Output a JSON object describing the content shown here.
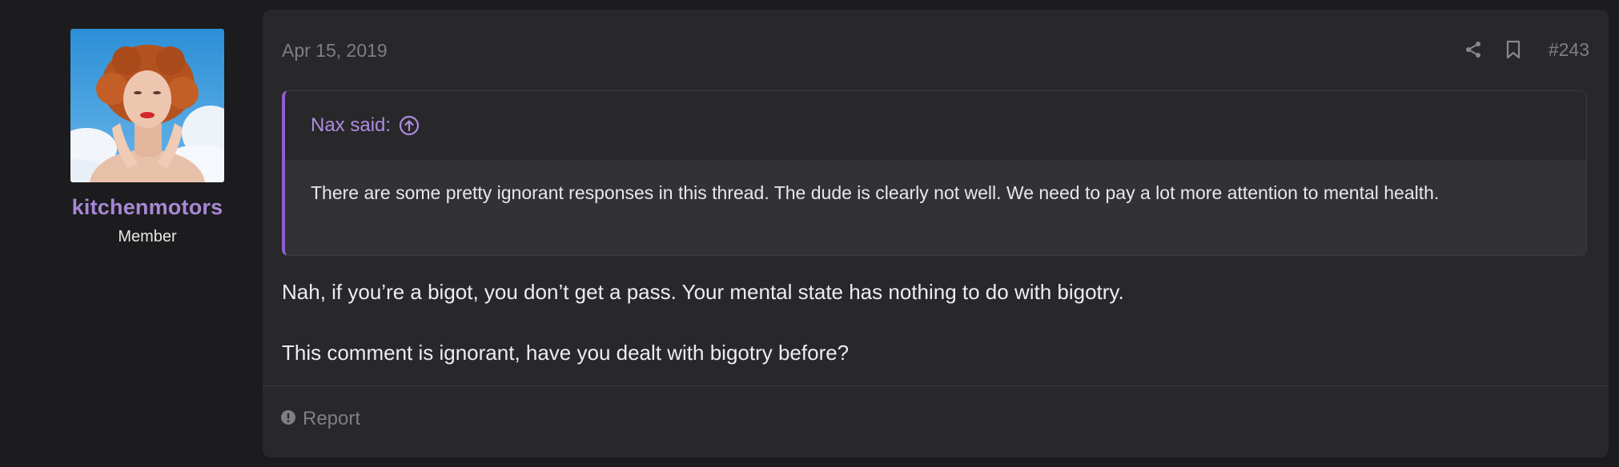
{
  "user": {
    "username": "kitchenmotors",
    "title": "Member",
    "avatar_icon": "user-avatar-photo"
  },
  "post": {
    "date": "Apr 15, 2019",
    "number": "#243",
    "share_icon": "share-icon",
    "bookmark_icon": "bookmark-icon",
    "quote": {
      "attribution": "Nax said:",
      "jump_icon": "arrow-up-circle-icon",
      "text": "There are some pretty ignorant responses in this thread. The dude is clearly not well. We need to pay a lot more attention to mental health."
    },
    "body": [
      "Nah, if you’re a bigot, you don’t get a pass. Your mental state has nothing to do with bigotry.",
      "This comment is ignorant, have you dealt with bigotry before?"
    ],
    "footer": {
      "report_label": "Report",
      "report_icon": "alert-circle-icon"
    }
  },
  "colors": {
    "background": "#1c1b1d",
    "card": "#28272a",
    "accent": "#a788d6",
    "quote_border": "#8e5fd0",
    "muted_text": "#7f7e83"
  }
}
